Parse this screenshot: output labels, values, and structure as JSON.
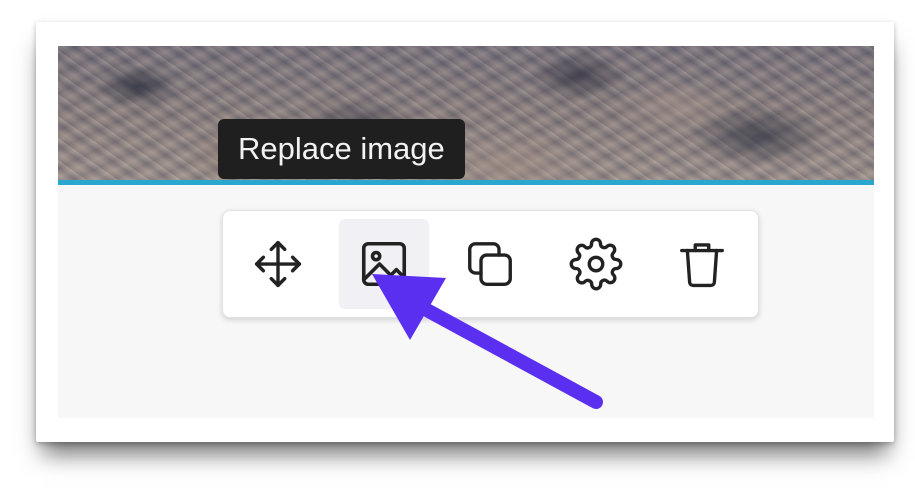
{
  "tooltip": {
    "text": "Replace image"
  },
  "toolbar": {
    "buttons": [
      {
        "icon": "move-icon",
        "action": "move"
      },
      {
        "icon": "image-icon",
        "action": "replace-image",
        "active": true
      },
      {
        "icon": "duplicate-icon",
        "action": "duplicate"
      },
      {
        "icon": "gear-icon",
        "action": "settings"
      },
      {
        "icon": "trash-icon",
        "action": "delete"
      }
    ]
  },
  "colors": {
    "accent_line": "#2aa7cf",
    "annotation_arrow": "#5b2ff0",
    "tooltip_bg": "#1f1f1f",
    "icon": "#222222"
  }
}
